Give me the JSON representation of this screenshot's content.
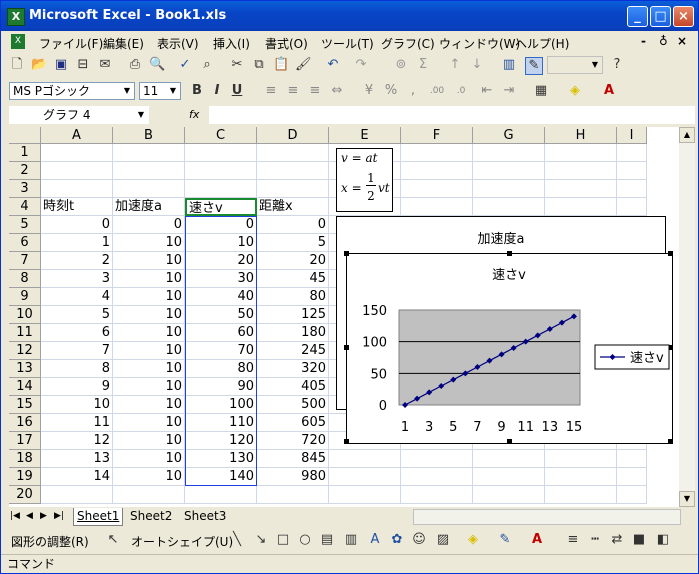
{
  "window": {
    "title": "Microsoft Excel - Book1.xls",
    "app_icon": "X"
  },
  "menu": {
    "items": [
      "ファイル(F)",
      "編集(E)",
      "表示(V)",
      "挿入(I)",
      "書式(O)",
      "ツール(T)",
      "グラフ(C)",
      "ウィンドウ(W)",
      "ヘルプ(H)"
    ],
    "mdi_controls": [
      "-",
      "♁",
      "×"
    ]
  },
  "format_toolbar": {
    "font": "MS Pゴシック",
    "size": "11",
    "bold": "B",
    "italic": "I",
    "underline": "U"
  },
  "formula_bar": {
    "name_box": "グラフ 4",
    "fx": "fx",
    "content": ""
  },
  "columns": [
    "A",
    "B",
    "C",
    "D",
    "E",
    "F",
    "G",
    "H",
    "I"
  ],
  "rows": [
    "1",
    "2",
    "3",
    "4",
    "5",
    "6",
    "7",
    "8",
    "9",
    "10",
    "11",
    "12",
    "13",
    "14",
    "15",
    "16",
    "17",
    "18",
    "19",
    "20"
  ],
  "headers_row4": {
    "a": "時刻t",
    "b": "加速度a",
    "c": "速さv",
    "d": "距離x"
  },
  "table": [
    [
      "0",
      "0",
      "0",
      "0"
    ],
    [
      "1",
      "10",
      "10",
      "5"
    ],
    [
      "2",
      "10",
      "20",
      "20"
    ],
    [
      "3",
      "10",
      "30",
      "45"
    ],
    [
      "4",
      "10",
      "40",
      "80"
    ],
    [
      "5",
      "10",
      "50",
      "125"
    ],
    [
      "6",
      "10",
      "60",
      "180"
    ],
    [
      "7",
      "10",
      "70",
      "245"
    ],
    [
      "8",
      "10",
      "80",
      "320"
    ],
    [
      "9",
      "10",
      "90",
      "405"
    ],
    [
      "10",
      "10",
      "100",
      "500"
    ],
    [
      "11",
      "10",
      "110",
      "605"
    ],
    [
      "12",
      "10",
      "120",
      "720"
    ],
    [
      "13",
      "10",
      "130",
      "845"
    ],
    [
      "14",
      "10",
      "140",
      "980"
    ]
  ],
  "formula_box": {
    "line1": "v = at",
    "line2_lhs": "x = ",
    "num": "1",
    "den": "2",
    "line2_rhs": "vt"
  },
  "chart_back": {
    "title": "加速度a"
  },
  "chart_data": {
    "type": "line",
    "title": "速さv",
    "x": [
      1,
      2,
      3,
      4,
      5,
      6,
      7,
      8,
      9,
      10,
      11,
      12,
      13,
      14,
      15
    ],
    "x_tick_labels": [
      "1",
      "3",
      "5",
      "7",
      "9",
      "11",
      "13",
      "15"
    ],
    "series": [
      {
        "name": "速さv",
        "values": [
          0,
          10,
          20,
          30,
          40,
          50,
          60,
          70,
          80,
          90,
          100,
          110,
          120,
          130,
          140
        ],
        "color": "#000080"
      }
    ],
    "ylim": [
      0,
      150
    ],
    "y_ticks": [
      "0",
      "50",
      "100",
      "150"
    ],
    "plot_bg": "#C0C0C0",
    "grid": true,
    "legend": "right"
  },
  "tabs": [
    "Sheet1",
    "Sheet2",
    "Sheet3"
  ],
  "drawing_toolbar": {
    "adjust": "図形の調整(R)",
    "autoshape": "オートシェイプ(U)"
  },
  "status": "コマンド"
}
